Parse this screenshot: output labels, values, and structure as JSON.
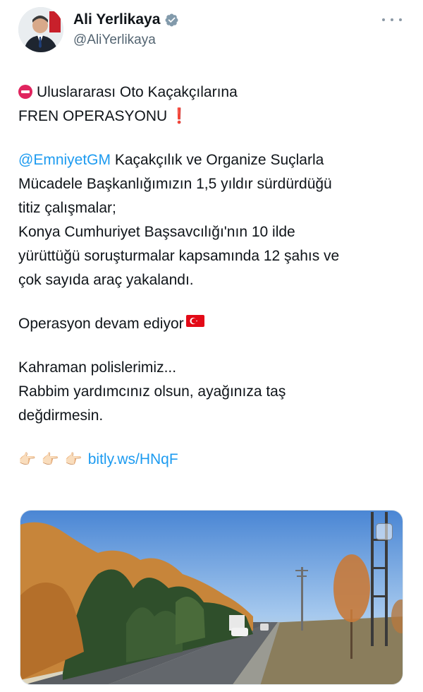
{
  "author": {
    "name": "Ali Yerlikaya",
    "handle": "@AliYerlikaya",
    "verified": true
  },
  "tweet": {
    "line1": "Uluslararası Oto Kaçakçılarına",
    "line2": "FREN OPERASYONU",
    "line2_emoji": "❗",
    "mention": "@EmniyetGM",
    "p1_rest": " Kaçakçılık ve Organize Suçlarla",
    "p1_l2": "Mücadele Başkanlığımızın 1,5 yıldır sürdürdüğü",
    "p1_l3": "titiz çalışmalar;",
    "p1_l4": "Konya Cumhuriyet Başsavcılığı'nın 10 ilde",
    "p1_l5": "yürüttüğü soruşturmalar kapsamında 12 şahıs ve",
    "p1_l6": "çok sayıda araç yakalandı.",
    "p2": "Operasyon devam ediyor",
    "p3_l1": "Kahraman polislerimiz...",
    "p3_l2": "Rabbim yardımcınız olsun, ayağınıza taş",
    "p3_l3": "değdirmesin.",
    "hands": [
      "👉🏻",
      "👉🏻",
      "👉🏻"
    ],
    "link": "bitly.ws/HNqF"
  },
  "icons": {
    "verified": "verified-badge-icon",
    "more": "more-options-icon",
    "no_entry": "no-entry-icon",
    "flag": "turkey-flag-icon",
    "media_badge": "media-tag-icon"
  },
  "colors": {
    "link": "#1d9bf0",
    "text": "#0f1419",
    "secondary": "#536471",
    "flag_red": "#e30a17"
  }
}
